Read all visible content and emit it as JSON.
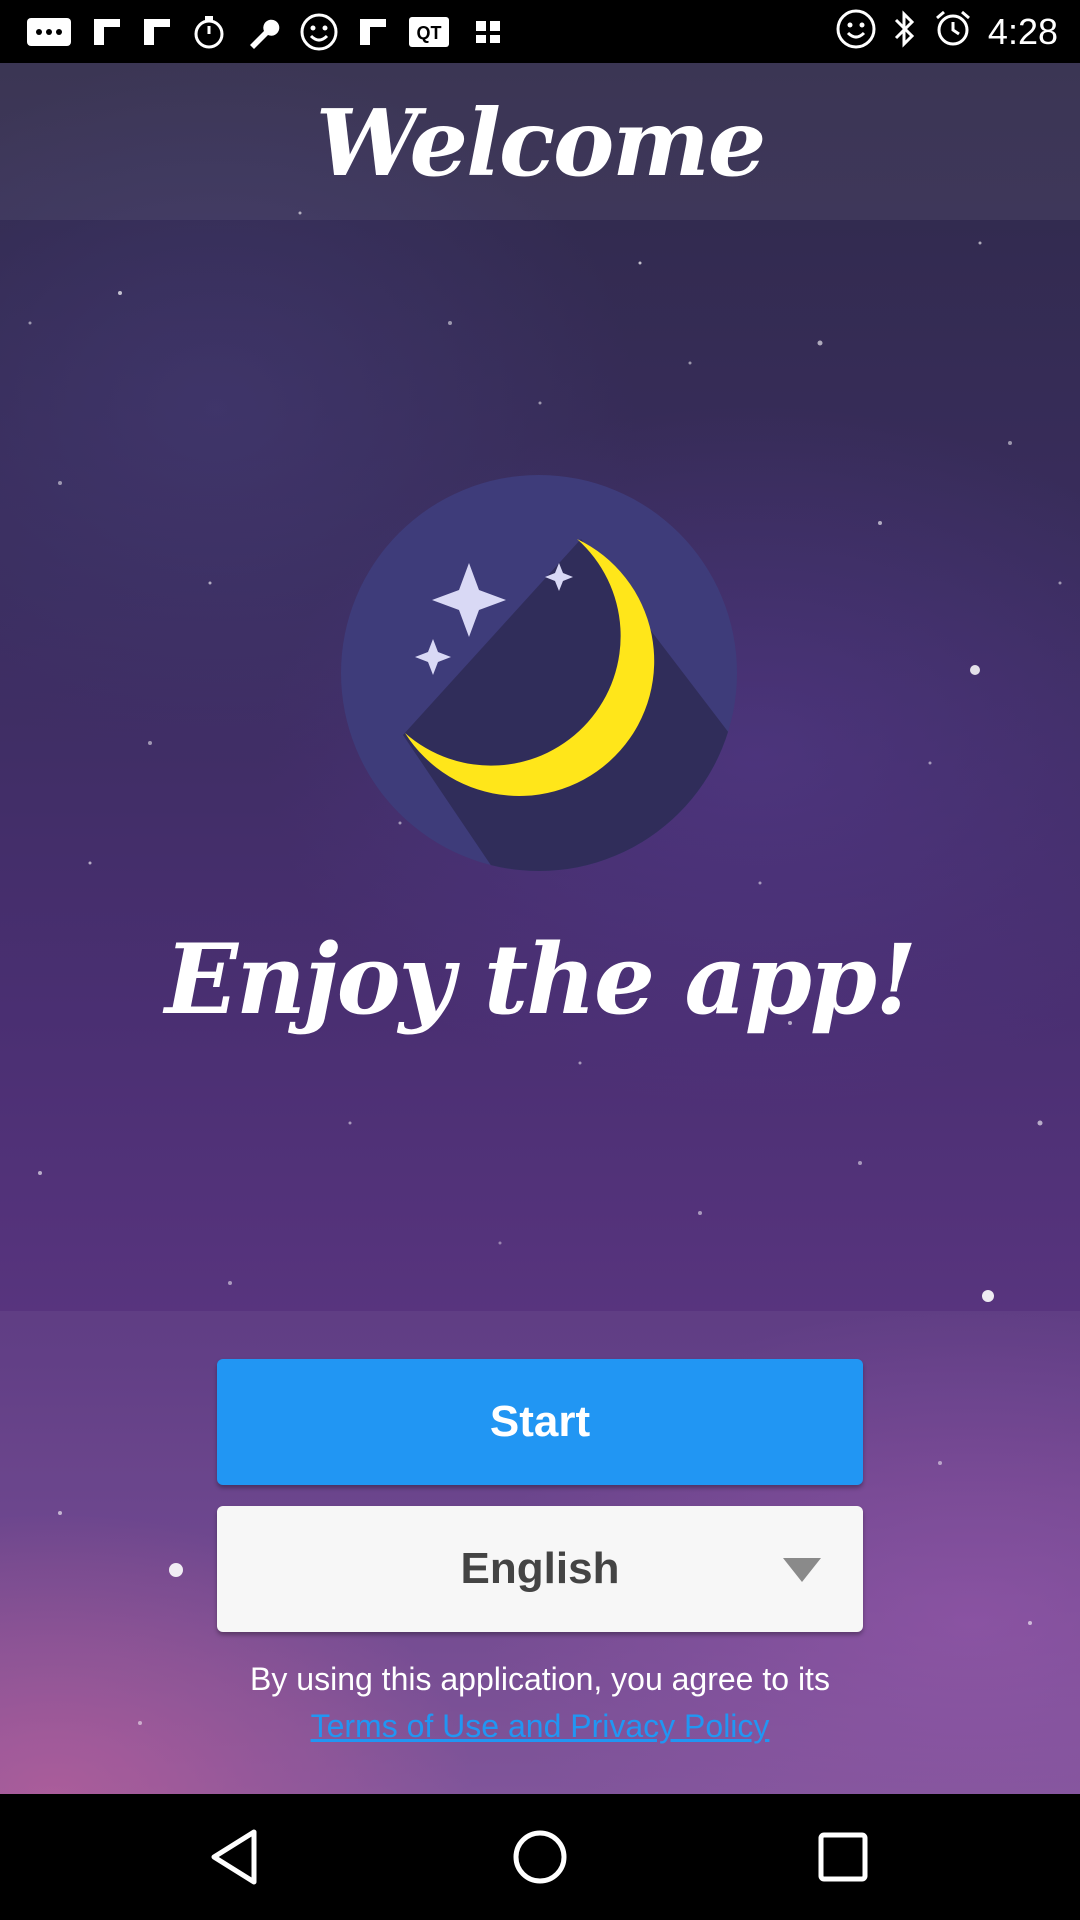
{
  "status_bar": {
    "time": "4:28",
    "left_icons": [
      "message-icon",
      "flipboard-icon",
      "flipboard-icon",
      "timer-icon",
      "wrench-icon",
      "smiley-icon",
      "flipboard-icon",
      "qt-icon",
      "settings-icon"
    ],
    "right_icons": [
      "smiley-icon",
      "bluetooth-icon",
      "alarm-icon"
    ]
  },
  "header": {
    "title": "Welcome"
  },
  "main": {
    "logo_icon": "moon-stars-icon",
    "tagline": "Enjoy the app!"
  },
  "actions": {
    "start_label": "Start",
    "language_value": "English",
    "agreement_text": "By using this application, you agree to its",
    "terms_link": "Terms of Use and Privacy Policy"
  },
  "colors": {
    "accent": "#2196f3",
    "moon": "#ffe61a",
    "logo_bg": "#3e3c7a"
  },
  "nav_bar": {
    "buttons": [
      "back-icon",
      "home-icon",
      "recents-icon"
    ]
  }
}
